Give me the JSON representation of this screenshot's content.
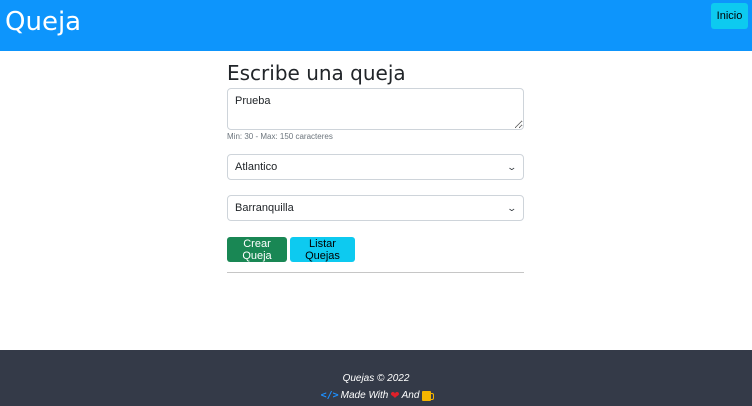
{
  "navbar": {
    "brand": "Queja",
    "home_label": "Inicio",
    "color": "#0d95fc"
  },
  "form": {
    "title": "Escribe una queja",
    "complaint_value": "Prueba",
    "hint": "Min: 30 - Max: 150 caracteres",
    "department_selected": "Atlantico",
    "city_selected": "Barranquilla",
    "create_label": "Crear Queja",
    "list_label": "Listar Quejas"
  },
  "footer": {
    "copyright": "Quejas © 2022",
    "made_with": "Made With",
    "and": "And",
    "icons": [
      "code-icon",
      "heart-icon",
      "beer-icon"
    ],
    "background": "#343a48"
  }
}
